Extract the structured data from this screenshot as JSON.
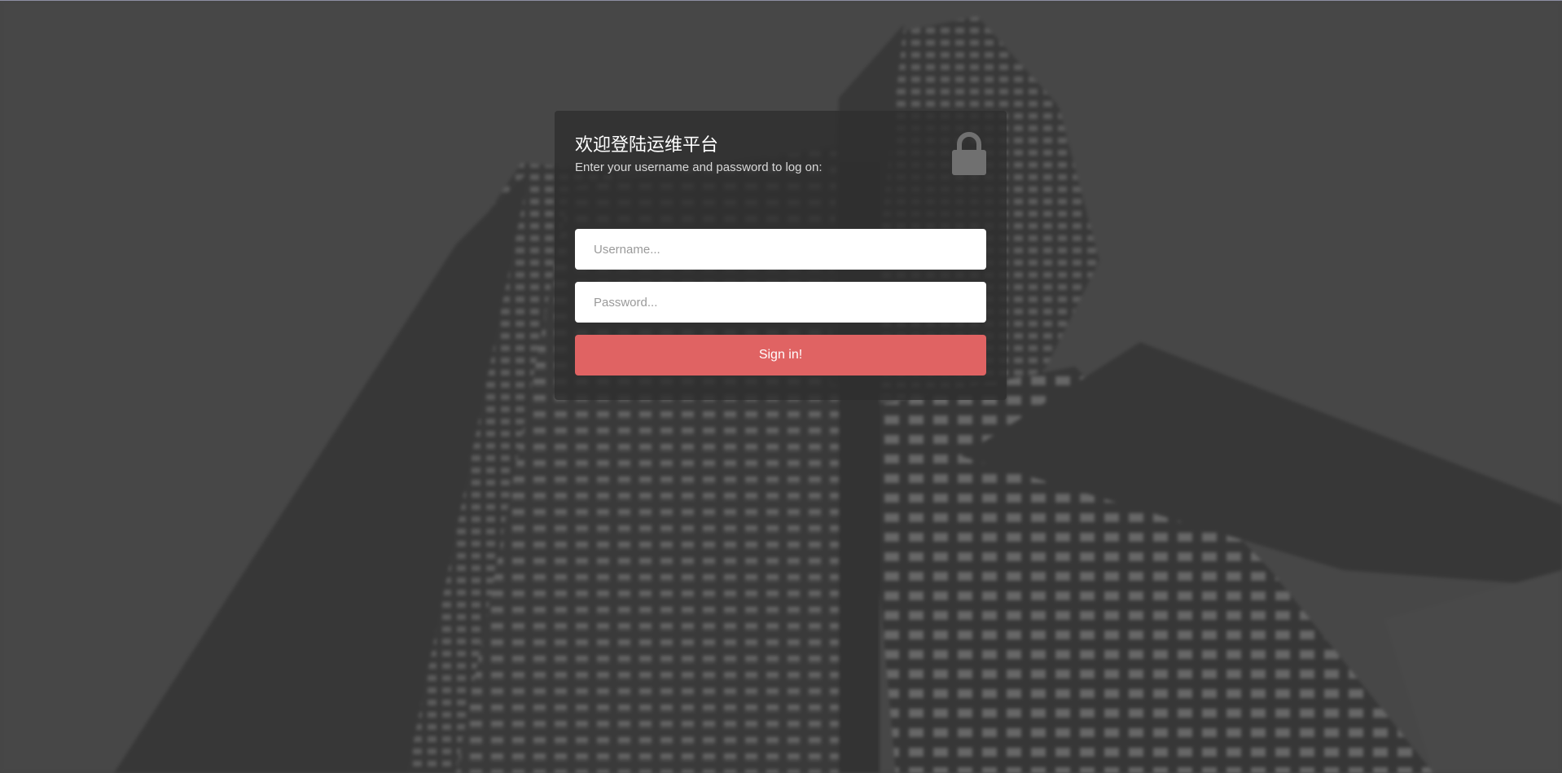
{
  "login": {
    "title": "欢迎登陆运维平台",
    "subtitle": "Enter your username and password to log on:",
    "lock_icon": "lock-icon",
    "username_placeholder": "Username...",
    "username_value": "",
    "password_placeholder": "Password...",
    "password_value": "",
    "signin_label": "Sign in!"
  },
  "colors": {
    "background": "#4a4a4a",
    "panel": "#2e2e2e",
    "accent": "#e06363",
    "lock": "#707070"
  }
}
